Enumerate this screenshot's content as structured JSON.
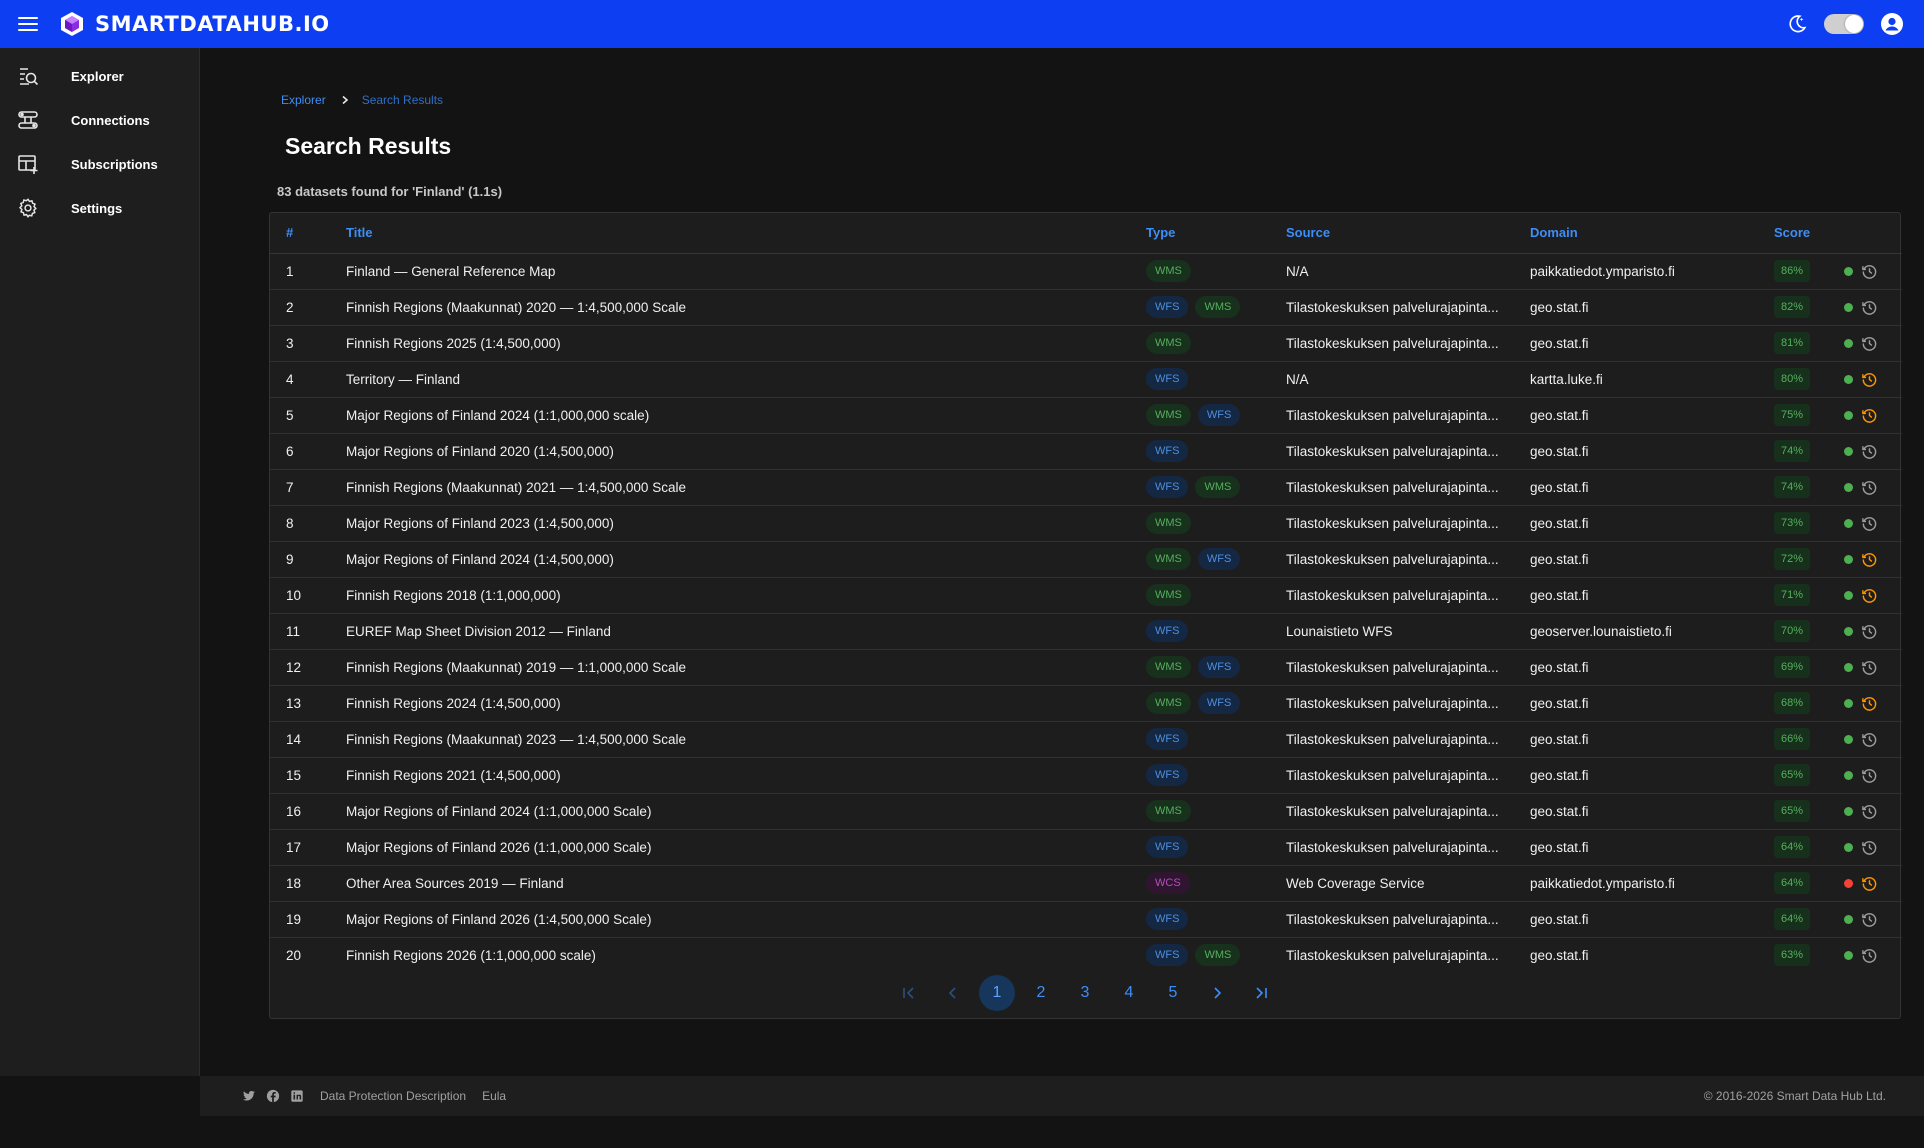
{
  "app": {
    "brand_name": "SMARTDATAHUB.IO",
    "brand_color": "#0d3ef2"
  },
  "sidebar": {
    "items": [
      {
        "label": "Explorer",
        "icon": "explorer-search-icon"
      },
      {
        "label": "Connections",
        "icon": "connections-icon"
      },
      {
        "label": "Subscriptions",
        "icon": "subscriptions-icon"
      },
      {
        "label": "Settings",
        "icon": "gear-icon"
      }
    ]
  },
  "breadcrumb": {
    "parent": "Explorer",
    "current": "Search Results"
  },
  "page": {
    "title": "Search Results",
    "summary": "83 datasets found for 'Finland' (1.1s)"
  },
  "table": {
    "headers": {
      "num": "#",
      "title": "Title",
      "type": "Type",
      "source": "Source",
      "domain": "Domain",
      "score": "Score"
    },
    "rows": [
      {
        "num": "1",
        "title": "Finland — General Reference Map",
        "types": [
          "WMS"
        ],
        "source": "N/A",
        "domain": "paikkatiedot.ymparisto.fi",
        "score": "86%",
        "status": "green",
        "history": "grey"
      },
      {
        "num": "2",
        "title": "Finnish Regions (Maakunnat) 2020 — 1:4,500,000 Scale",
        "types": [
          "WFS",
          "WMS"
        ],
        "source": "Tilastokeskuksen palvelurajapinta...",
        "domain": "geo.stat.fi",
        "score": "82%",
        "status": "green",
        "history": "grey"
      },
      {
        "num": "3",
        "title": "Finnish Regions 2025 (1:4,500,000)",
        "types": [
          "WMS"
        ],
        "source": "Tilastokeskuksen palvelurajapinta...",
        "domain": "geo.stat.fi",
        "score": "81%",
        "status": "green",
        "history": "grey"
      },
      {
        "num": "4",
        "title": "Territory — Finland",
        "types": [
          "WFS"
        ],
        "source": "N/A",
        "domain": "kartta.luke.fi",
        "score": "80%",
        "status": "green",
        "history": "orange"
      },
      {
        "num": "5",
        "title": "Major Regions of Finland 2024 (1:1,000,000 scale)",
        "types": [
          "WMS",
          "WFS"
        ],
        "source": "Tilastokeskuksen palvelurajapinta...",
        "domain": "geo.stat.fi",
        "score": "75%",
        "status": "green",
        "history": "orange"
      },
      {
        "num": "6",
        "title": "Major Regions of Finland 2020 (1:4,500,000)",
        "types": [
          "WFS"
        ],
        "source": "Tilastokeskuksen palvelurajapinta...",
        "domain": "geo.stat.fi",
        "score": "74%",
        "status": "green",
        "history": "grey"
      },
      {
        "num": "7",
        "title": "Finnish Regions (Maakunnat) 2021 — 1:4,500,000 Scale",
        "types": [
          "WFS",
          "WMS"
        ],
        "source": "Tilastokeskuksen palvelurajapinta...",
        "domain": "geo.stat.fi",
        "score": "74%",
        "status": "green",
        "history": "grey"
      },
      {
        "num": "8",
        "title": "Major Regions of Finland 2023 (1:4,500,000)",
        "types": [
          "WMS"
        ],
        "source": "Tilastokeskuksen palvelurajapinta...",
        "domain": "geo.stat.fi",
        "score": "73%",
        "status": "green",
        "history": "grey"
      },
      {
        "num": "9",
        "title": "Major Regions of Finland 2024 (1:4,500,000)",
        "types": [
          "WMS",
          "WFS"
        ],
        "source": "Tilastokeskuksen palvelurajapinta...",
        "domain": "geo.stat.fi",
        "score": "72%",
        "status": "green",
        "history": "orange"
      },
      {
        "num": "10",
        "title": "Finnish Regions 2018 (1:1,000,000)",
        "types": [
          "WMS"
        ],
        "source": "Tilastokeskuksen palvelurajapinta...",
        "domain": "geo.stat.fi",
        "score": "71%",
        "status": "green",
        "history": "orange"
      },
      {
        "num": "11",
        "title": "EUREF Map Sheet Division 2012 — Finland",
        "types": [
          "WFS"
        ],
        "source": "Lounaistieto WFS",
        "domain": "geoserver.lounaistieto.fi",
        "score": "70%",
        "status": "green",
        "history": "grey"
      },
      {
        "num": "12",
        "title": "Finnish Regions (Maakunnat) 2019 — 1:1,000,000 Scale",
        "types": [
          "WMS",
          "WFS"
        ],
        "source": "Tilastokeskuksen palvelurajapinta...",
        "domain": "geo.stat.fi",
        "score": "69%",
        "status": "green",
        "history": "grey"
      },
      {
        "num": "13",
        "title": "Finnish Regions 2024 (1:4,500,000)",
        "types": [
          "WMS",
          "WFS"
        ],
        "source": "Tilastokeskuksen palvelurajapinta...",
        "domain": "geo.stat.fi",
        "score": "68%",
        "status": "green",
        "history": "orange"
      },
      {
        "num": "14",
        "title": "Finnish Regions (Maakunnat) 2023 — 1:4,500,000 Scale",
        "types": [
          "WFS"
        ],
        "source": "Tilastokeskuksen palvelurajapinta...",
        "domain": "geo.stat.fi",
        "score": "66%",
        "status": "green",
        "history": "grey"
      },
      {
        "num": "15",
        "title": "Finnish Regions 2021 (1:4,500,000)",
        "types": [
          "WFS"
        ],
        "source": "Tilastokeskuksen palvelurajapinta...",
        "domain": "geo.stat.fi",
        "score": "65%",
        "status": "green",
        "history": "grey"
      },
      {
        "num": "16",
        "title": "Major Regions of Finland 2024 (1:1,000,000 Scale)",
        "types": [
          "WMS"
        ],
        "source": "Tilastokeskuksen palvelurajapinta...",
        "domain": "geo.stat.fi",
        "score": "65%",
        "status": "green",
        "history": "grey"
      },
      {
        "num": "17",
        "title": "Major Regions of Finland 2026 (1:1,000,000 Scale)",
        "types": [
          "WFS"
        ],
        "source": "Tilastokeskuksen palvelurajapinta...",
        "domain": "geo.stat.fi",
        "score": "64%",
        "status": "green",
        "history": "grey"
      },
      {
        "num": "18",
        "title": "Other Area Sources 2019 — Finland",
        "types": [
          "WCS"
        ],
        "source": "Web Coverage Service",
        "domain": "paikkatiedot.ymparisto.fi",
        "score": "64%",
        "status": "red",
        "history": "orange"
      },
      {
        "num": "19",
        "title": "Major Regions of Finland 2026 (1:4,500,000 Scale)",
        "types": [
          "WFS"
        ],
        "source": "Tilastokeskuksen palvelurajapinta...",
        "domain": "geo.stat.fi",
        "score": "64%",
        "status": "green",
        "history": "grey"
      },
      {
        "num": "20",
        "title": "Finnish Regions 2026 (1:1,000,000 scale)",
        "types": [
          "WFS",
          "WMS"
        ],
        "source": "Tilastokeskuksen palvelurajapinta...",
        "domain": "geo.stat.fi",
        "score": "63%",
        "status": "green",
        "history": "grey"
      }
    ]
  },
  "pagination": {
    "pages": [
      "1",
      "2",
      "3",
      "4",
      "5"
    ],
    "current": "1"
  },
  "footer": {
    "links": [
      "Data Protection Description",
      "Eula"
    ],
    "copyright": "© 2016-2026 Smart Data Hub Ltd."
  },
  "colors": {
    "status_green": "#4caf50",
    "status_red": "#f44336",
    "history_grey": "#9e9e9e",
    "history_orange": "#ff9800"
  }
}
